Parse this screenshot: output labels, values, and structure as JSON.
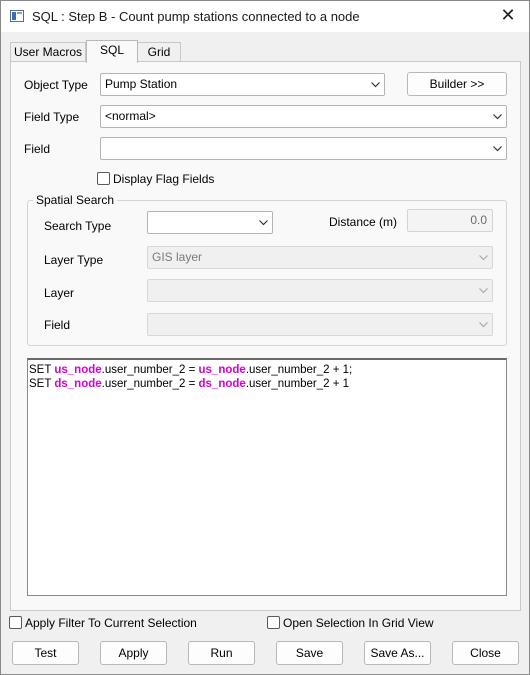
{
  "window": {
    "title": "SQL : Step B - Count pump stations connected to a node",
    "close_glyph": "✕",
    "app_icon": "sql-window-icon"
  },
  "tabs": [
    {
      "label": "User Macros",
      "active": false
    },
    {
      "label": "SQL",
      "active": true
    },
    {
      "label": "Grid",
      "active": false
    }
  ],
  "form": {
    "object_type_label": "Object Type",
    "object_type_value": "Pump Station",
    "builder_label": "Builder >>",
    "field_type_label": "Field Type",
    "field_type_value": "<normal>",
    "field_label": "Field",
    "field_value": "",
    "display_flag_fields_label": "Display Flag Fields",
    "display_flag_fields_checked": false
  },
  "spatial": {
    "title": "Spatial Search",
    "search_type_label": "Search Type",
    "search_type_value": "",
    "distance_label": "Distance (m)",
    "distance_value": "0.0",
    "layer_type_label": "Layer Type",
    "layer_type_value": "GIS layer",
    "layer_label": "Layer",
    "layer_value": "",
    "field_label": "Field",
    "field_value": ""
  },
  "sql": {
    "lines": [
      {
        "p1": "SET ",
        "k1": "us_node",
        "p2": ".user_number_2 = ",
        "k2": "us_node",
        "p3": ".user_number_2 + 1;"
      },
      {
        "p1": "SET ",
        "k1": "ds_node",
        "p2": ".user_number_2 = ",
        "k2": "ds_node",
        "p3": ".user_number_2 + 1"
      }
    ],
    "keyword_color": "#d400d4"
  },
  "options": {
    "apply_filter_label": "Apply Filter To Current Selection",
    "apply_filter_checked": false,
    "open_grid_label": "Open Selection In Grid View",
    "open_grid_checked": false
  },
  "buttons": {
    "test": "Test",
    "apply": "Apply",
    "run": "Run",
    "save": "Save",
    "save_as": "Save As...",
    "close": "Close"
  }
}
